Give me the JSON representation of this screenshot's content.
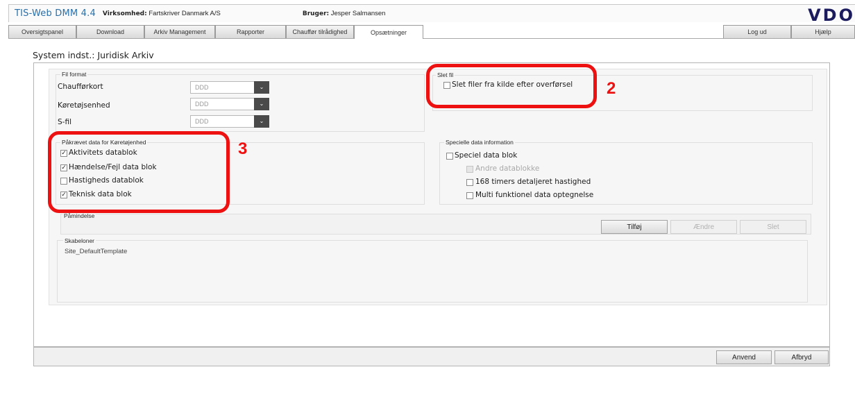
{
  "header": {
    "app_title": "TIS-Web DMM 4.4",
    "company_label": "Virksomhed:",
    "company_value": "Fartskriver Danmark A/S",
    "user_label": "Bruger:",
    "user_value": "Jesper Salmansen",
    "logo": "VDO"
  },
  "tabs": [
    {
      "label": "Oversigtspanel"
    },
    {
      "label": "Download"
    },
    {
      "label": "Arkiv Management"
    },
    {
      "label": "Rapporter"
    },
    {
      "label": "Chauffør tilrådighed"
    },
    {
      "label": "Opsætninger"
    }
  ],
  "active_tab": "Opsætninger",
  "right_tabs": {
    "logout": "Log ud",
    "help": "Hjælp"
  },
  "page_title": "System indst.: Juridisk Arkiv",
  "fil_format": {
    "legend": "Fil format",
    "rows": [
      {
        "label": "Chaufførkort",
        "value": "DDD"
      },
      {
        "label": "Køretøjsenhed",
        "value": "DDD"
      },
      {
        "label": "S-fil",
        "value": "DDD"
      }
    ]
  },
  "slet_fil": {
    "legend": "Slet fil",
    "checkbox_label": "Slet filer fra kilde efter overførsel",
    "checked": false
  },
  "paakraevet": {
    "legend": "Påkrævet data for Køretøjenhed",
    "items": [
      {
        "label": "Aktivitets datablok",
        "checked": true,
        "mark": "✓"
      },
      {
        "label": "Hændelse/Fejl data blok",
        "checked": true,
        "mark": "✓"
      },
      {
        "label": "Hastigheds datablok",
        "checked": false,
        "mark": ""
      },
      {
        "label": "Teknisk data blok",
        "checked": true,
        "mark": "✓"
      }
    ]
  },
  "specielle": {
    "legend": "Specielle data information",
    "main_label": "Speciel data blok",
    "sub_items": [
      {
        "label": "Andre datablokke",
        "disabled": true
      },
      {
        "label": "168 timers detaljeret hastighed",
        "disabled": false
      },
      {
        "label": "Multi funktionel data optegnelse",
        "disabled": false
      }
    ]
  },
  "paamindelse": {
    "legend": "Påmindelse",
    "buttons": {
      "add": "Tilføj",
      "edit": "Ændre",
      "delete": "Slet"
    }
  },
  "skabeloner": {
    "legend": "Skabeloner",
    "items": [
      "Site_DefaultTemplate"
    ]
  },
  "footer": {
    "apply": "Anvend",
    "cancel": "Afbryd"
  },
  "annotations": {
    "num2": "2",
    "num3": "3"
  },
  "colors": {
    "highlight": "#ee1111",
    "title": "#2a6fa8",
    "logo": "#1b1b5e"
  },
  "icons": {
    "select_arrow": "chevron-down-icon"
  }
}
